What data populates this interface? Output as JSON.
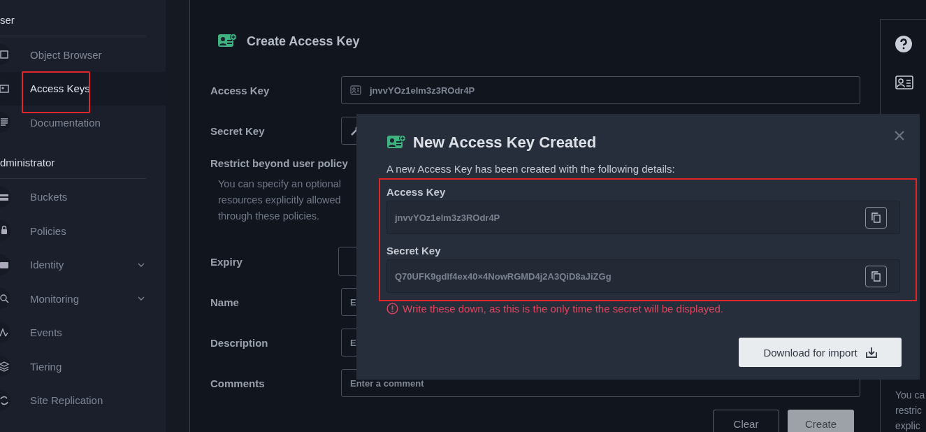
{
  "sidebar": {
    "sections": [
      {
        "title": "ser",
        "items": [
          {
            "label": "Object Browser",
            "selected": false,
            "submenu": false,
            "annotated": false
          },
          {
            "label": "Access Keys",
            "selected": true,
            "submenu": false,
            "annotated": true
          },
          {
            "label": "Documentation",
            "selected": false,
            "submenu": false,
            "annotated": false
          }
        ]
      },
      {
        "title": "dministrator",
        "items": [
          {
            "label": "Buckets",
            "selected": false,
            "submenu": false,
            "annotated": false
          },
          {
            "label": "Policies",
            "selected": false,
            "submenu": false,
            "annotated": false
          },
          {
            "label": "Identity",
            "selected": false,
            "submenu": true,
            "annotated": false
          },
          {
            "label": "Monitoring",
            "selected": false,
            "submenu": true,
            "annotated": false
          },
          {
            "label": "Events",
            "selected": false,
            "submenu": false,
            "annotated": false
          },
          {
            "label": "Tiering",
            "selected": false,
            "submenu": false,
            "annotated": false
          },
          {
            "label": "Site Replication",
            "selected": false,
            "submenu": false,
            "annotated": false
          }
        ]
      }
    ]
  },
  "form": {
    "title": "Create Access Key",
    "access_key": {
      "label": "Access Key",
      "value": "jnvvYOz1elm3z3ROdr4P"
    },
    "secret_key": {
      "label": "Secret Key"
    },
    "restrict": {
      "label": "Restrict beyond user policy",
      "lines": [
        "You can specify an optional",
        "resources explicitly allowed",
        "through these policies."
      ]
    },
    "expiry": {
      "label": "Expiry"
    },
    "name": {
      "label": "Name",
      "placeholder": "E"
    },
    "description": {
      "label": "Description",
      "placeholder": "E"
    },
    "comments": {
      "label": "Comments",
      "placeholder": "Enter a comment"
    },
    "buttons": [
      "Clear",
      "Create"
    ]
  },
  "help_panel": {
    "lines": [
      "You ca",
      "restric",
      "explic"
    ]
  },
  "modal": {
    "title": "New Access Key Created",
    "intro": "A new Access Key has been created with the following details:",
    "annotated": true,
    "keys": [
      {
        "label": "Access Key",
        "value": "jnvvYOz1elm3z3ROdr4P"
      },
      {
        "label": "Secret Key",
        "value": "Q70UFK9gdlf4ex40×4NowRGMD4j2A3QiD8aJiZGg"
      }
    ],
    "warning": "Write these down, as this is the only time the secret will be displayed.",
    "download": "Download for import"
  }
}
